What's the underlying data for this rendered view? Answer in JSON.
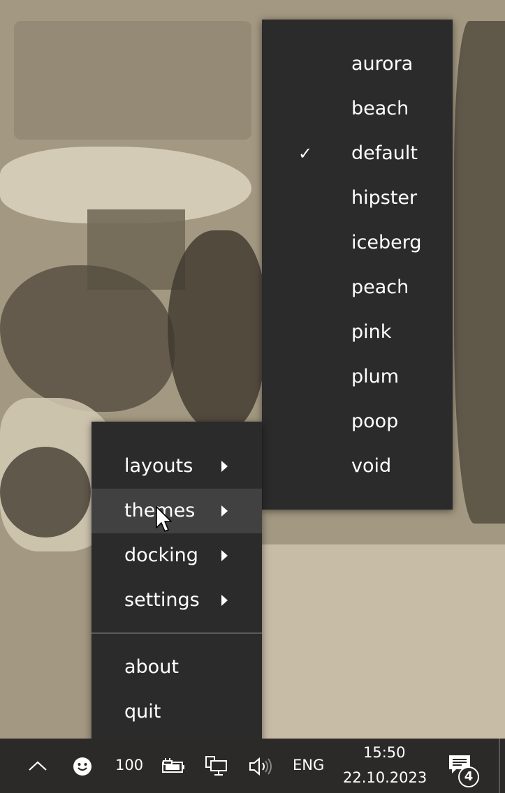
{
  "context_menu": {
    "items": [
      {
        "label": "layouts",
        "has_submenu": true
      },
      {
        "label": "themes",
        "has_submenu": true,
        "hovered": true
      },
      {
        "label": "docking",
        "has_submenu": true
      },
      {
        "label": "settings",
        "has_submenu": true
      },
      {
        "label": "about",
        "has_submenu": false
      },
      {
        "label": "quit",
        "has_submenu": false
      }
    ]
  },
  "themes_submenu": {
    "items": [
      {
        "label": "aurora",
        "checked": false
      },
      {
        "label": "beach",
        "checked": false
      },
      {
        "label": "default",
        "checked": true
      },
      {
        "label": "hipster",
        "checked": false
      },
      {
        "label": "iceberg",
        "checked": false
      },
      {
        "label": "peach",
        "checked": false
      },
      {
        "label": "pink",
        "checked": false
      },
      {
        "label": "plum",
        "checked": false
      },
      {
        "label": "poop",
        "checked": false
      },
      {
        "label": "void",
        "checked": false
      }
    ],
    "check_glyph": "✓"
  },
  "taskbar": {
    "tray_count": "100",
    "language": "ENG",
    "time": "15:50",
    "date": "22.10.2023",
    "notification_count": "4",
    "icons": [
      "chevron-up-icon",
      "smiley-icon",
      "power-plug-battery-icon",
      "network-icon",
      "volume-icon",
      "notification-icon"
    ]
  },
  "colors": {
    "menu_bg": "#2b2b2b",
    "menu_hover": "#414141",
    "taskbar_bg": "#2c2a29",
    "text": "#ffffff"
  }
}
